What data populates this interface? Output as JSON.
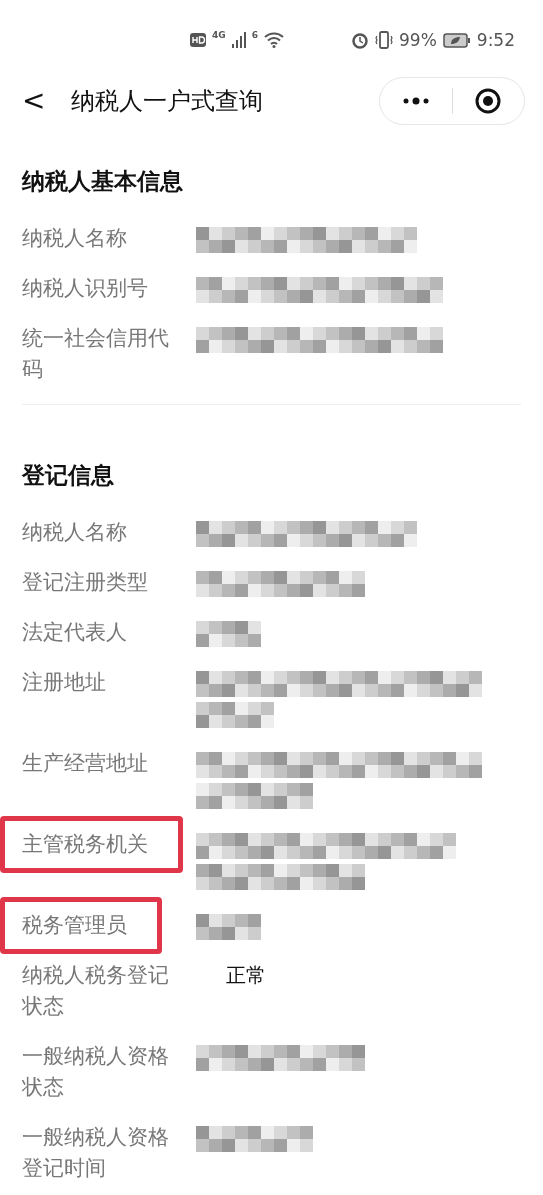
{
  "status_bar": {
    "network": "4G",
    "wifi_label": "6",
    "battery": "99%",
    "time": "9:52"
  },
  "nav": {
    "back": "<",
    "title": "纳税人一户式查询"
  },
  "sections": [
    {
      "title": "纳税人基本信息",
      "divider": true,
      "rows": [
        {
          "label": "纳税人名称",
          "redacted": true,
          "highlighted": false
        },
        {
          "label": "纳税人识别号",
          "redacted": true,
          "highlighted": false
        },
        {
          "label": "统一社会信用代码",
          "redacted": true,
          "highlighted": false
        }
      ]
    },
    {
      "title": "登记信息",
      "divider": false,
      "rows": [
        {
          "label": "纳税人名称",
          "redacted": true,
          "highlighted": false
        },
        {
          "label": "登记注册类型",
          "redacted": true,
          "highlighted": false
        },
        {
          "label": "法定代表人",
          "redacted": true,
          "highlighted": false
        },
        {
          "label": "注册地址",
          "redacted": true,
          "highlighted": false
        },
        {
          "label": "生产经营地址",
          "redacted": true,
          "highlighted": false
        },
        {
          "label": "主管税务机关",
          "redacted": true,
          "highlighted": true
        },
        {
          "label": "税务管理员",
          "redacted": true,
          "highlighted": true
        },
        {
          "label": "纳税人税务登记状态",
          "redacted": false,
          "value": "正常",
          "highlighted": false
        },
        {
          "label": "一般纳税人资格状态",
          "redacted": true,
          "highlighted": false
        },
        {
          "label": "一般纳税人资格登记时间",
          "redacted": true,
          "highlighted": false
        }
      ]
    }
  ]
}
